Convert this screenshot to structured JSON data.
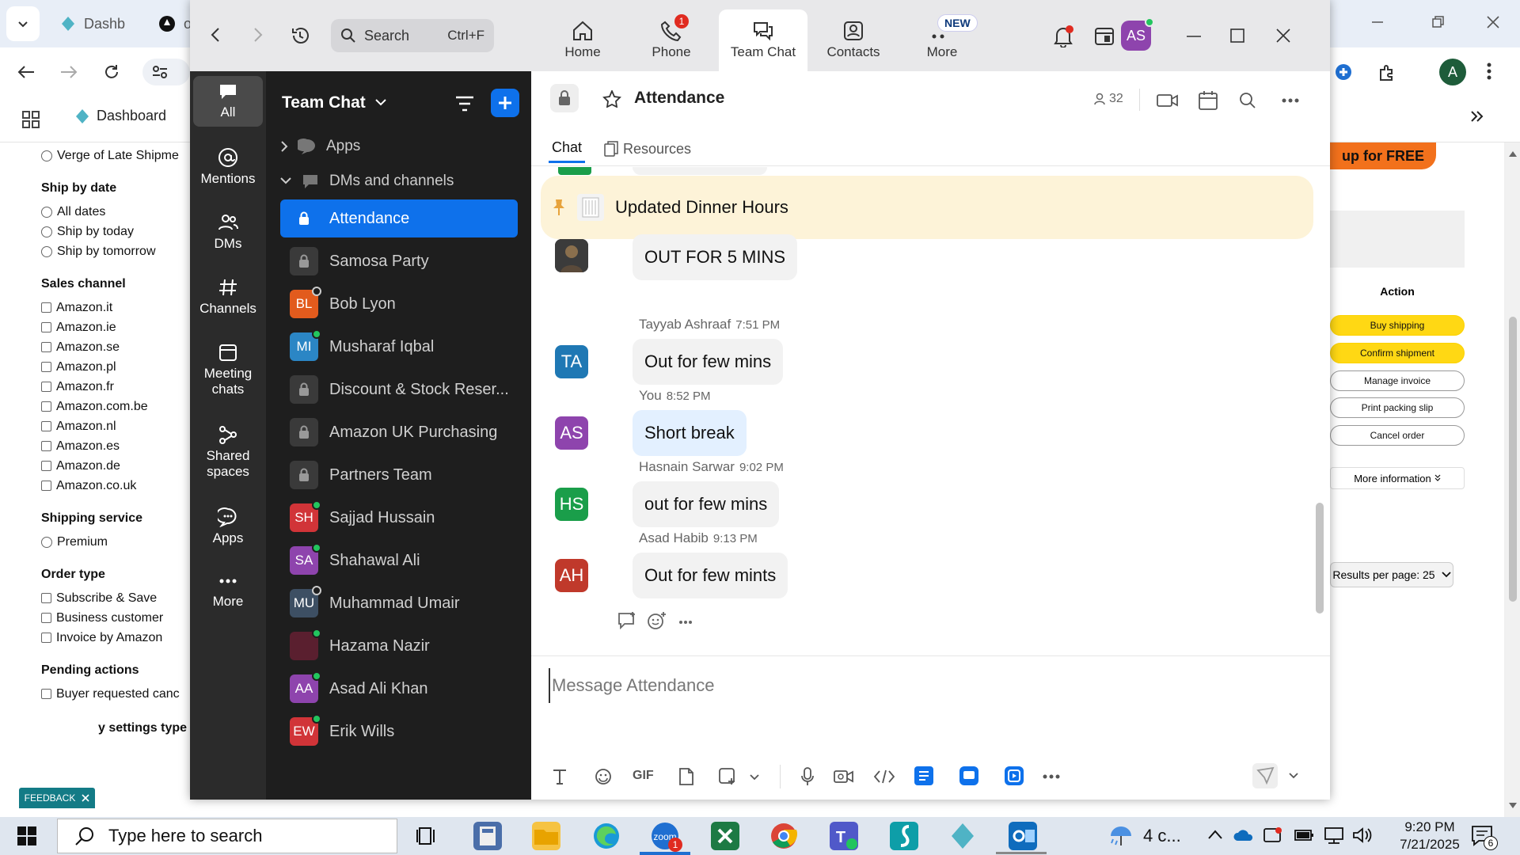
{
  "browser": {
    "tabs": [
      {
        "label": "Dashb"
      },
      {
        "label": "o"
      }
    ],
    "bookmarks": {
      "label": "Dashboard"
    },
    "profile_initial": "A"
  },
  "filters": {
    "top_option": "Verge of Late Shipme",
    "ship_by_date": {
      "heading": "Ship by date",
      "options": [
        "All dates",
        "Ship by today",
        "Ship by tomorrow"
      ]
    },
    "sales_channel": {
      "heading": "Sales channel",
      "options": [
        "Amazon.it",
        "Amazon.ie",
        "Amazon.se",
        "Amazon.pl",
        "Amazon.fr",
        "Amazon.com.be",
        "Amazon.nl",
        "Amazon.es",
        "Amazon.de",
        "Amazon.co.uk"
      ]
    },
    "shipping_service": {
      "heading": "Shipping service",
      "options": [
        "Premium"
      ]
    },
    "order_type": {
      "heading": "Order type",
      "options": [
        "Subscribe & Save",
        "Business customer",
        "Invoice by Amazon"
      ]
    },
    "pending_actions": {
      "heading": "Pending actions",
      "options": [
        "Buyer requested canc"
      ]
    },
    "cut_heading": "y settings type",
    "feedback": "FEEDBACK"
  },
  "amazon_panel": {
    "promo": "up for FREE",
    "action_header": "Action",
    "buttons": [
      "Buy shipping",
      "Confirm shipment",
      "Manage invoice",
      "Print packing slip",
      "Cancel order"
    ],
    "more_info": "More information",
    "results_per_page": "Results per page: 25"
  },
  "zoom": {
    "search": {
      "placeholder": "Search",
      "shortcut": "Ctrl+F"
    },
    "tabs": [
      {
        "label": "Home"
      },
      {
        "label": "Phone",
        "badge": "1"
      },
      {
        "label": "Team Chat"
      },
      {
        "label": "Contacts"
      },
      {
        "label": "More",
        "badge": "NEW"
      }
    ],
    "user_initials": "AS",
    "rail": [
      {
        "label": "All"
      },
      {
        "label": "Mentions"
      },
      {
        "label": "DMs"
      },
      {
        "label": "Channels"
      },
      {
        "label": "Meeting chats"
      },
      {
        "label": "Shared spaces"
      },
      {
        "label": "Apps"
      },
      {
        "label": "More"
      }
    ],
    "list_title": "Team Chat",
    "sections": {
      "apps": "Apps",
      "dms": "DMs and channels"
    },
    "channels": [
      {
        "name": "Attendance",
        "type": "lock"
      },
      {
        "name": "Samosa Party",
        "type": "lock"
      },
      {
        "name": "Bob Lyon",
        "initials": "BL",
        "color": "#e25b1d",
        "status": "away"
      },
      {
        "name": "Musharaf Iqbal",
        "initials": "MI",
        "color": "#2b86c5",
        "status": "green"
      },
      {
        "name": "Discount & Stock Reser...",
        "type": "lock"
      },
      {
        "name": "Amazon UK Purchasing",
        "type": "lock"
      },
      {
        "name": "Partners Team",
        "type": "lock"
      },
      {
        "name": "Sajjad Hussain",
        "initials": "SH",
        "color": "#d13438",
        "status": "green"
      },
      {
        "name": "Shahawal Ali",
        "initials": "SA",
        "color": "#8e44ad",
        "status": "green"
      },
      {
        "name": "Muhammad Umair",
        "initials": "MU",
        "color": "#3d4f63",
        "status": "away"
      },
      {
        "name": "Hazama Nazir",
        "initials": "",
        "color": "#5a1f2f",
        "status": "green"
      },
      {
        "name": "Asad Ali Khan",
        "initials": "AA",
        "color": "#8e44ad",
        "status": "green"
      },
      {
        "name": "Erik Wills",
        "initials": "EW",
        "color": "#d13438",
        "status": "green"
      }
    ],
    "channel_header": {
      "name": "Attendance",
      "members": "32"
    },
    "chat_tabs": {
      "chat": "Chat",
      "resources": "Resources"
    },
    "pinned": "Updated Dinner Hours",
    "messages": [
      {
        "sender": "",
        "time": "",
        "text": "OUT FOR 5 MINS",
        "initials": "",
        "color": "#333"
      },
      {
        "sender": "Tayyab Ashraaf",
        "time": "7:51 PM",
        "text": "Out for few mins",
        "initials": "TA",
        "color": "#1f78b4"
      },
      {
        "sender": "You",
        "time": "8:52 PM",
        "text": "Short break",
        "initials": "AS",
        "color": "#8e44ad"
      },
      {
        "sender": "Hasnain Sarwar",
        "time": "9:02 PM",
        "text": "out for few mins",
        "initials": "HS",
        "color": "#1a9e4a"
      },
      {
        "sender": "Asad Habib",
        "time": "9:13 PM",
        "text": "Out for few mints",
        "initials": "AH",
        "color": "#c0392b"
      }
    ],
    "composer_placeholder": "Message Attendance",
    "gif_label": "GIF",
    "accent": "#0e71eb"
  },
  "taskbar": {
    "search_placeholder": "Type here to search",
    "weather": "4 c...",
    "time": "9:20 PM",
    "date": "7/21/2025",
    "notification_count": "6",
    "zoom_badge": "1"
  }
}
